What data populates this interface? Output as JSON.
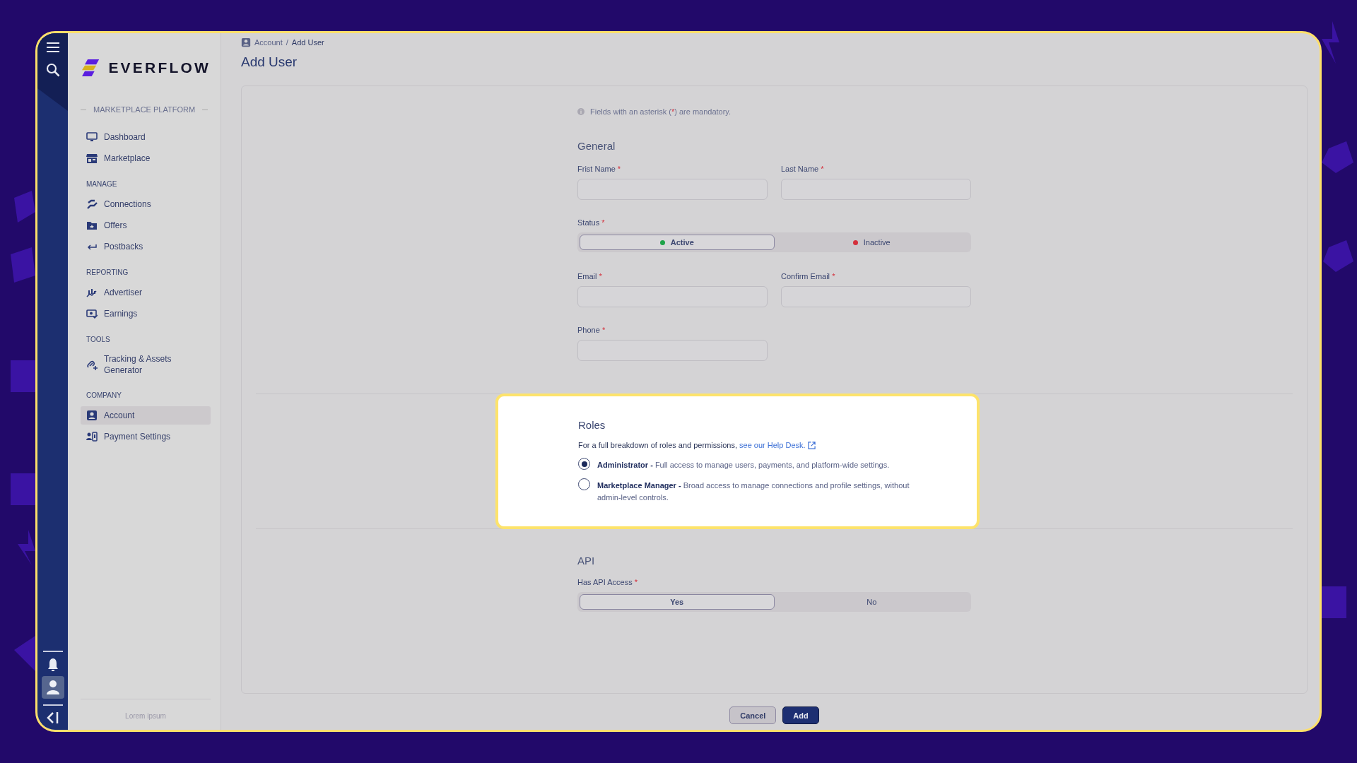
{
  "brand": {
    "name": "EVERFLOW"
  },
  "sidebar": {
    "platform_label": "MARKETPLACE PLATFORM",
    "sections": [
      {
        "items": [
          {
            "label": "Dashboard",
            "selected": false
          },
          {
            "label": "Marketplace",
            "selected": false
          }
        ]
      },
      {
        "heading": "MANAGE",
        "items": [
          {
            "label": "Connections",
            "selected": false
          },
          {
            "label": "Offers",
            "selected": false
          },
          {
            "label": "Postbacks",
            "selected": false
          }
        ]
      },
      {
        "heading": "REPORTING",
        "items": [
          {
            "label": "Advertiser",
            "selected": false
          },
          {
            "label": "Earnings",
            "selected": false
          }
        ]
      },
      {
        "heading": "TOOLS",
        "items": [
          {
            "label": "Tracking & Assets Generator",
            "selected": false
          }
        ]
      },
      {
        "heading": "COMPANY",
        "items": [
          {
            "label": "Account",
            "selected": true
          },
          {
            "label": "Payment Settings",
            "selected": false
          }
        ]
      }
    ],
    "footer": "Lorem ipsum"
  },
  "breadcrumb_separator": "/",
  "breadcrumb": [
    {
      "label": "Account",
      "current": false
    },
    {
      "label": "Add User",
      "current": true
    }
  ],
  "title": "Add User",
  "notice": {
    "before": "Fields with an asterisk (",
    "mark": "*",
    "after": ") are mandatory."
  },
  "general": {
    "heading": "General",
    "rows": [
      {
        "kind": "fields",
        "fields": [
          {
            "label": "Frist Name",
            "required": true
          },
          {
            "label": "Last Name",
            "required": true
          }
        ]
      },
      {
        "kind": "segmented",
        "label": "Status",
        "required": true,
        "options": [
          {
            "label": "Active",
            "color": "#1fa34a",
            "selected": true
          },
          {
            "label": "Inactive",
            "color": "#d4303c",
            "selected": false
          }
        ]
      },
      {
        "kind": "fields",
        "fields": [
          {
            "label": "Email",
            "required": true
          },
          {
            "label": "Confirm Email",
            "required": true
          }
        ]
      },
      {
        "kind": "fields",
        "fields": [
          {
            "label": "Phone",
            "required": true
          }
        ]
      }
    ]
  },
  "roles": {
    "heading": "Roles",
    "intro": "For a full breakdown of roles and permissions,",
    "link": "see our Help Desk.",
    "options": [
      {
        "text": "**Administrator -** Full access to manage users, payments, and platform-wide settings.",
        "selected": true
      },
      {
        "text": "**Marketplace Manager -** Broad access to manage connections and profile settings, without admin-level controls.",
        "selected": false
      }
    ]
  },
  "api": {
    "heading": "API",
    "rows": [
      {
        "kind": "segmented",
        "label": "Has API Access",
        "required": true,
        "options": [
          {
            "label": "Yes",
            "selected": true
          },
          {
            "label": "No",
            "selected": false
          }
        ]
      }
    ]
  },
  "buttons": [
    {
      "label": "Cancel",
      "kind": "secondary"
    },
    {
      "label": "Add",
      "kind": "primary"
    }
  ]
}
